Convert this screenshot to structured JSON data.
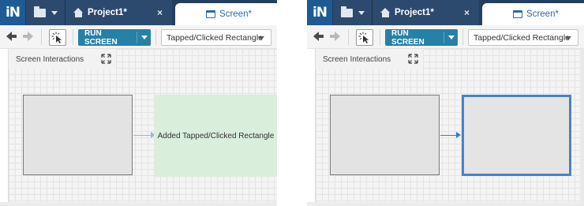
{
  "app": {
    "logo_text": "iN",
    "project_tab_label": "Project1*",
    "project_close": "×",
    "screen_tab_label": "Screen*"
  },
  "toolbar": {
    "run_label": "RUN SCREEN",
    "event_select_value": "Tapped/Clicked Rectangle"
  },
  "canvas": {
    "panel_title": "Screen Interactions"
  },
  "left_panel": {
    "added_rect_label": "Added Tapped/Clicked Rectangle"
  },
  "icons": {
    "logo": "app-logo-icon",
    "folder": "folder-icon",
    "home": "home-icon",
    "screen": "screen-icon",
    "back": "back-arrow-icon",
    "forward": "forward-arrow-icon",
    "select_tool": "select-cursor-icon",
    "expand": "expand-icon"
  },
  "colors": {
    "header_bg": "#233e5e",
    "tab_accent": "#2e6aa3",
    "run_button": "#2780a6",
    "added_rect_fill": "#d9eedb",
    "target_rect_border": "#4a82c6",
    "connector_left": "#9ab7da",
    "connector_right": "#3d78c4"
  }
}
